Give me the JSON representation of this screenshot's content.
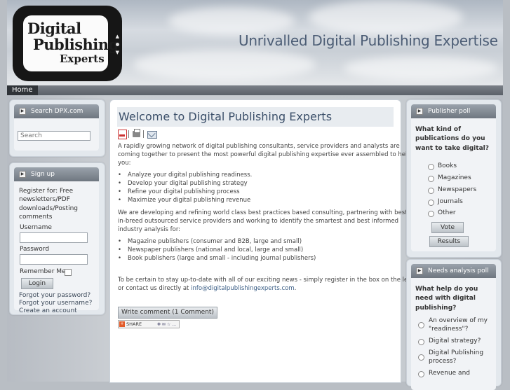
{
  "header": {
    "logo": {
      "line1": "Digital",
      "line2": "Publishing",
      "line3": "Experts"
    },
    "tagline": "Unrivalled Digital Publishing Expertise"
  },
  "nav": {
    "home": "Home"
  },
  "search": {
    "title": "Search DPX.com",
    "placeholder": "Search"
  },
  "signup": {
    "title": "Sign up",
    "intro": [
      "Register for: Free",
      "newsletters/PDF",
      "downloads/Posting",
      "comments"
    ],
    "username_label": "Username",
    "password_label": "Password",
    "remember_label": "Remember Me",
    "login_label": "Login",
    "links": [
      "Forgot your password?",
      "Forgot your username?",
      "Create an account"
    ]
  },
  "article": {
    "title": "Welcome to Digital Publishing Experts",
    "icons": [
      "pdf-icon",
      "print-icon",
      "email-icon"
    ],
    "intro": [
      "A rapidly growing network of digital publishing consultants, service providers and analysts are",
      "coming together to present the most powerful digital publishing expertise ever assembled to help",
      "you:"
    ],
    "bullets1": [
      "Analyze your digital publishing readiness.",
      "Develop your digital publishing strategy",
      "Refine your digital publishing process",
      "Maximize your digital publishing revenue"
    ],
    "para2": [
      "We are developing and refining world class best practices based consulting, partnering with best-",
      "in-breed outsourced service providers and working to identify the smartest and best informed",
      "industry analysis for:"
    ],
    "bullets2": [
      "Magazine publishers (consumer and B2B, large and small)",
      "Newspaper publishers (national and local, large and small)",
      "Book publishers (large and small - including journal publishers)"
    ],
    "para3_line1": "To be certain to stay up-to-date with all of our exciting news - simply register in the box on the left",
    "para3_line2_prefix": "or contact us directly at ",
    "para3_email": "info@digitalpublishingexperts.com",
    "para3_line2_suffix": ".",
    "comment_button": "Write comment (1 Comment)",
    "share_label": "SHARE"
  },
  "publisher_poll": {
    "title": "Publisher poll",
    "question": [
      "What kind of",
      "publications do you",
      "want to take digital?"
    ],
    "options": [
      "Books",
      "Magazines",
      "Newspapers",
      "Journals",
      "Other"
    ],
    "vote_label": "Vote",
    "results_label": "Results"
  },
  "needs_poll": {
    "title": "Needs analysis poll",
    "question": [
      "What help do you",
      "need with digital",
      "publishing?"
    ],
    "options": [
      [
        "An overview of my",
        "\"readiness\"?"
      ],
      [
        "Digital strategy?"
      ],
      [
        "Digital Publishing",
        "process?"
      ],
      [
        "Revenue and"
      ]
    ]
  }
}
